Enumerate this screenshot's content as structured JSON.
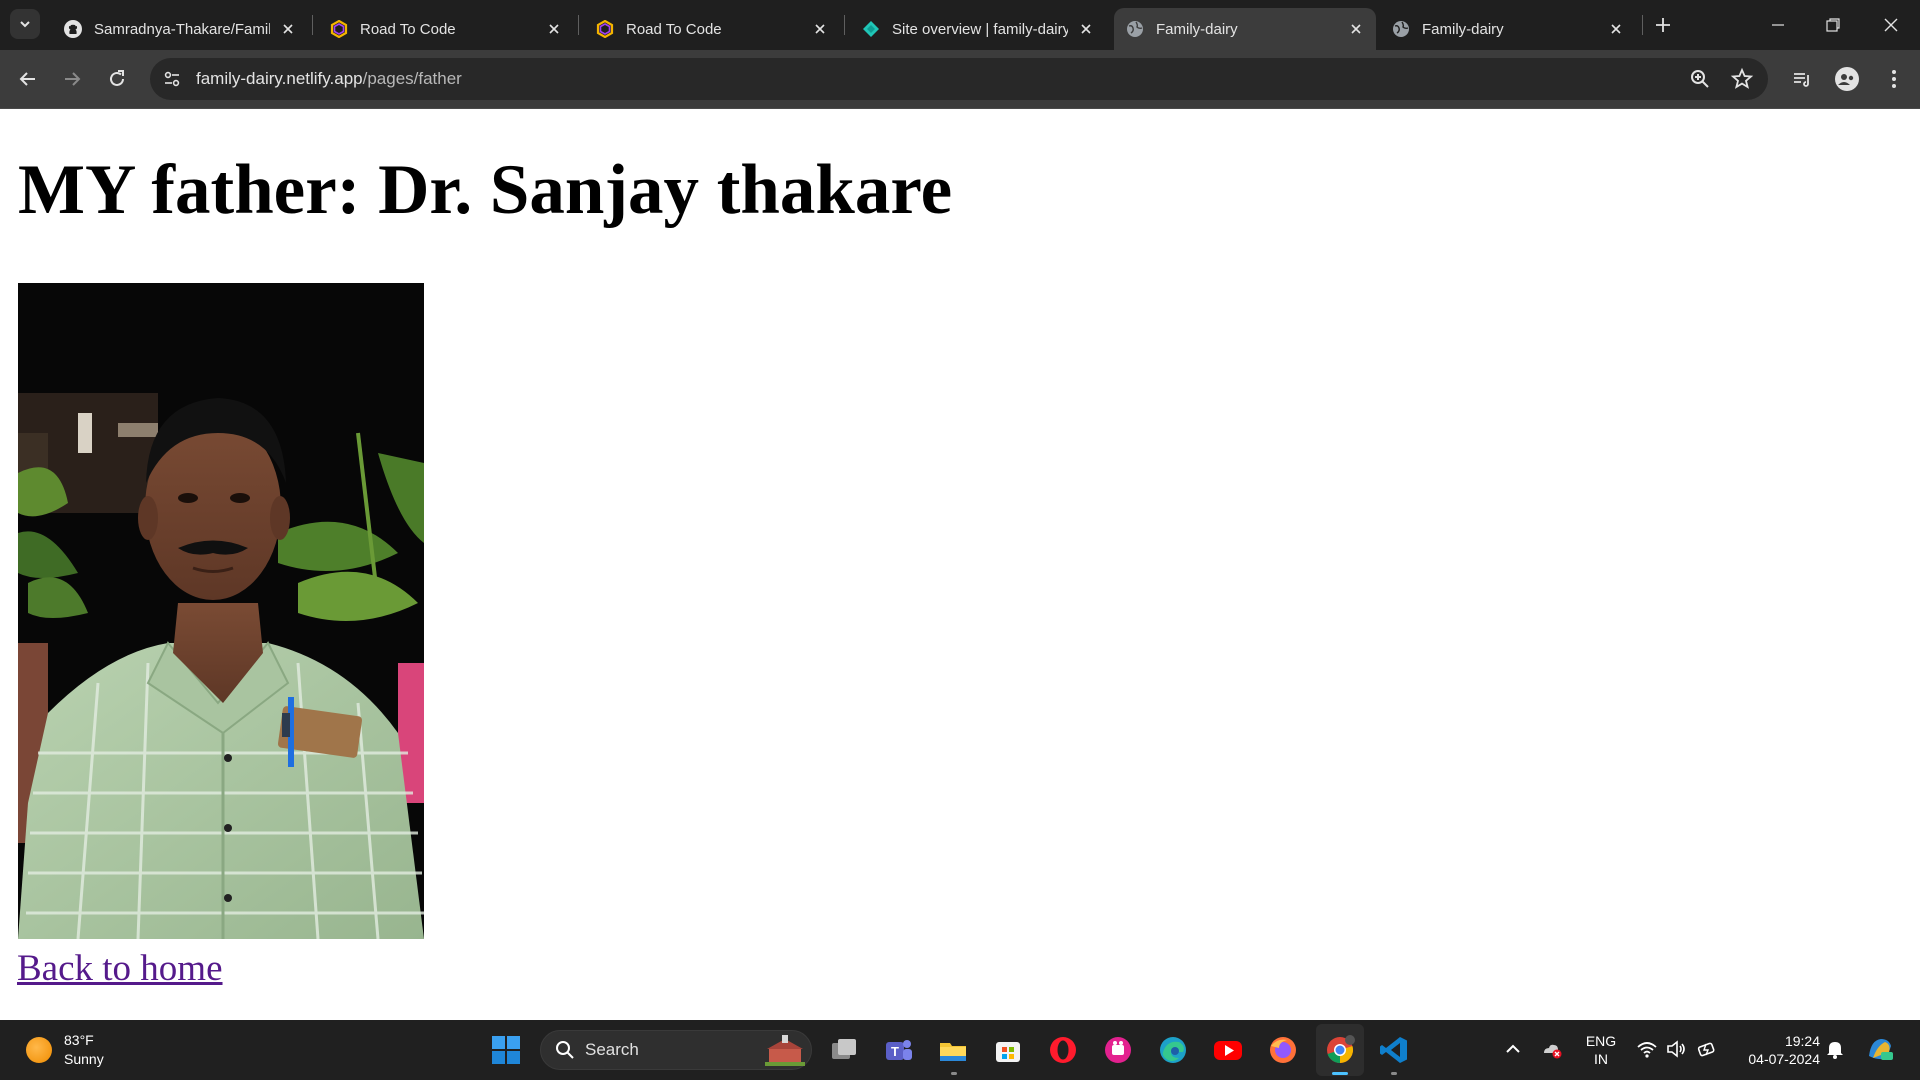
{
  "browser": {
    "tabs": [
      {
        "title": "Samradnya-Thakare/Family",
        "favicon": "github-icon",
        "active": false
      },
      {
        "title": "Road To Code",
        "favicon": "road-to-code-icon",
        "active": false
      },
      {
        "title": "Road To Code",
        "favicon": "road-to-code-icon",
        "active": false
      },
      {
        "title": "Site overview | family-dairy",
        "favicon": "netlify-icon",
        "active": false
      },
      {
        "title": "Family-dairy",
        "favicon": "globe-icon",
        "active": true
      },
      {
        "title": "Family-dairy",
        "favicon": "globe-icon",
        "active": false
      }
    ],
    "url_host": "family-dairy.netlify.app",
    "url_path": "/pages/father"
  },
  "page": {
    "heading": "MY father: Dr. Sanjay thakare",
    "back_link": "Back to home"
  },
  "taskbar": {
    "weather_temp": "83°F",
    "weather_desc": "Sunny",
    "search_placeholder": "Search",
    "lang_top": "ENG",
    "lang_bottom": "IN",
    "time": "19:24",
    "date": "04-07-2024"
  },
  "colors": {
    "tabbar_bg": "#1f1f1f",
    "toolbar_bg": "#3c3c3c",
    "link_visited": "#551a8b",
    "taskbar_bg": "#202020"
  }
}
